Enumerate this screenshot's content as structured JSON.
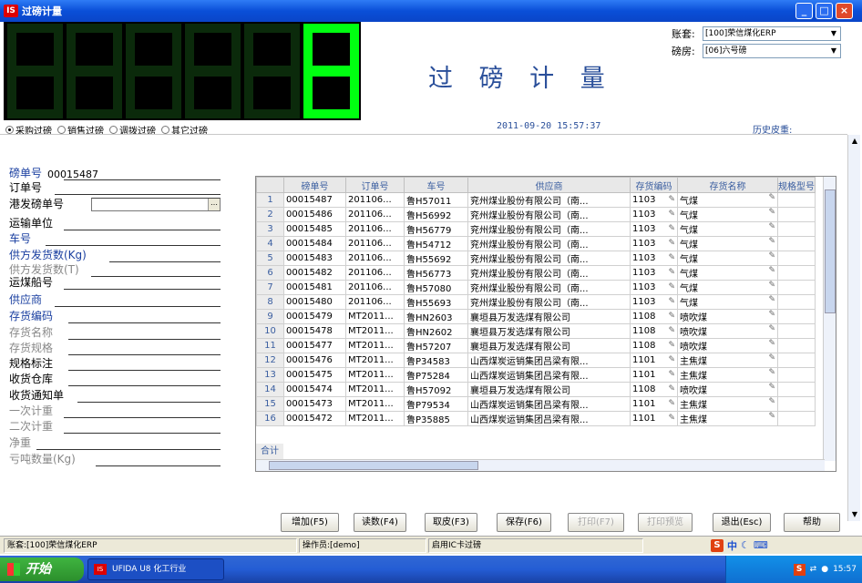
{
  "window": {
    "title": "过磅计量",
    "logo": "IS",
    "min": "_",
    "max": "□",
    "close": "×"
  },
  "lcd": {
    "digits": 6,
    "active_digit": 6,
    "display": "8"
  },
  "header": {
    "big_title": "过 磅 计 量",
    "account_label": "账套:",
    "account_value": "[100]荣信煤化ERP",
    "scale_label": "磅房:",
    "scale_value": "[06]六号磅",
    "datetime": "2011-09-20 15:57:37",
    "history_tare": "历史皮重:"
  },
  "modes": [
    {
      "label": "采购过磅",
      "selected": true
    },
    {
      "label": "销售过磅",
      "selected": false
    },
    {
      "label": "调拨过磅",
      "selected": false
    },
    {
      "label": "其它过磅",
      "selected": false
    }
  ],
  "form": {
    "fields": [
      {
        "label": "磅单号",
        "value": "00015487",
        "style": "blue"
      },
      {
        "label": "订单号",
        "value": "",
        "style": "black"
      },
      {
        "label": "港发磅单号",
        "value": "",
        "style": "black",
        "input": true
      },
      {
        "label": "运输单位",
        "value": "",
        "style": "black"
      },
      {
        "label": "车号",
        "value": "",
        "style": "blue"
      },
      {
        "label": "供方发货数(Kg)",
        "value": "",
        "style": "blue"
      },
      {
        "label": "供方发货数(T)",
        "value": "",
        "style": "gray"
      },
      {
        "label": "运煤船号",
        "value": "",
        "style": "black"
      },
      {
        "label": "供应商",
        "value": "",
        "style": "blue"
      },
      {
        "label": "存货编码",
        "value": "",
        "style": "blue"
      },
      {
        "label": "存货名称",
        "value": "",
        "style": "gray"
      },
      {
        "label": "存货规格",
        "value": "",
        "style": "gray"
      },
      {
        "label": "规格标注",
        "value": "",
        "style": "black"
      },
      {
        "label": "收货仓库",
        "value": "",
        "style": "black"
      },
      {
        "label": "收货通知单",
        "value": "",
        "style": "black"
      },
      {
        "label": "一次计重",
        "value": "",
        "style": "gray"
      },
      {
        "label": "二次计重",
        "value": "",
        "style": "gray"
      },
      {
        "label": "净重",
        "value": "",
        "style": "gray"
      },
      {
        "label": "亏吨数量(Kg)",
        "value": "",
        "style": "gray"
      }
    ]
  },
  "grid": {
    "columns": [
      "磅单号",
      "订单号",
      "车号",
      "供应商",
      "存货编码",
      "存货名称",
      "规格型号"
    ],
    "rows": [
      [
        "1",
        "00015487",
        "201106...",
        "鲁H57011",
        "兖州煤业股份有限公司（南...",
        "1103",
        "气煤"
      ],
      [
        "2",
        "00015486",
        "201106...",
        "鲁H56992",
        "兖州煤业股份有限公司（南...",
        "1103",
        "气煤"
      ],
      [
        "3",
        "00015485",
        "201106...",
        "鲁H56779",
        "兖州煤业股份有限公司（南...",
        "1103",
        "气煤"
      ],
      [
        "4",
        "00015484",
        "201106...",
        "鲁H54712",
        "兖州煤业股份有限公司（南...",
        "1103",
        "气煤"
      ],
      [
        "5",
        "00015483",
        "201106...",
        "鲁H55692",
        "兖州煤业股份有限公司（南...",
        "1103",
        "气煤"
      ],
      [
        "6",
        "00015482",
        "201106...",
        "鲁H56773",
        "兖州煤业股份有限公司（南...",
        "1103",
        "气煤"
      ],
      [
        "7",
        "00015481",
        "201106...",
        "鲁H57080",
        "兖州煤业股份有限公司（南...",
        "1103",
        "气煤"
      ],
      [
        "8",
        "00015480",
        "201106...",
        "鲁H55693",
        "兖州煤业股份有限公司（南...",
        "1103",
        "气煤"
      ],
      [
        "9",
        "00015479",
        "MT2011...",
        "鲁HN2603",
        "襄垣县万发选煤有限公司",
        "1108",
        "喷吹煤"
      ],
      [
        "10",
        "00015478",
        "MT2011...",
        "鲁HN2602",
        "襄垣县万发选煤有限公司",
        "1108",
        "喷吹煤"
      ],
      [
        "11",
        "00015477",
        "MT2011...",
        "鲁H57207",
        "襄垣县万发选煤有限公司",
        "1108",
        "喷吹煤"
      ],
      [
        "12",
        "00015476",
        "MT2011...",
        "鲁P34583",
        "山西煤炭运销集团吕梁有限...",
        "1101",
        "主焦煤"
      ],
      [
        "13",
        "00015475",
        "MT2011...",
        "鲁P75284",
        "山西煤炭运销集团吕梁有限...",
        "1101",
        "主焦煤"
      ],
      [
        "14",
        "00015474",
        "MT2011...",
        "鲁H57092",
        "襄垣县万发选煤有限公司",
        "1108",
        "喷吹煤"
      ],
      [
        "15",
        "00015473",
        "MT2011...",
        "鲁P79534",
        "山西煤炭运销集团吕梁有限...",
        "1101",
        "主焦煤"
      ],
      [
        "16",
        "00015472",
        "MT2011...",
        "鲁P35885",
        "山西煤炭运销集团吕梁有限...",
        "1101",
        "主焦煤"
      ]
    ],
    "sum_label": "合计"
  },
  "buttons": [
    {
      "label": "增加(F5)",
      "enabled": true
    },
    {
      "label": "读数(F4)",
      "enabled": true
    },
    {
      "label": "取皮(F3)",
      "enabled": true
    },
    {
      "label": "保存(F6)",
      "enabled": true
    },
    {
      "label": "打印(F7)",
      "enabled": false
    },
    {
      "label": "打印预览",
      "enabled": false
    },
    {
      "label": "退出(Esc)",
      "enabled": true
    },
    {
      "label": "帮助",
      "enabled": true
    }
  ],
  "status": {
    "account": "账套:[100]荣信煤化ERP",
    "operator": "操作员:[demo]",
    "mode": "启用IC卡过磅"
  },
  "taskbar": {
    "start": "开始",
    "task": "UFIDA U8 化工行业",
    "time": "15:57",
    "ime_s": "S",
    "ime_text": "中"
  }
}
